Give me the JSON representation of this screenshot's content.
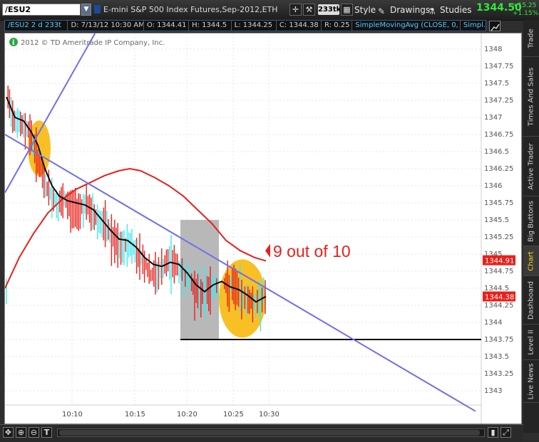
{
  "toolbar": {
    "symbol": "/ESU2",
    "title": "E-mini S&P 500 Index Futures,Sep-2012,ETH",
    "tick_aggregation": "233tk",
    "style_label": "Style",
    "drawings_label": "Drawings",
    "studies_label": "Studies",
    "last_price": "1344.50",
    "net_change": "+15.25",
    "pct_change": "+1.15%"
  },
  "infobar": {
    "symbol": "/ESU2 2 d 233t",
    "datetime": "D: 7/13/12 10:30 AM",
    "open": "O: 1344.41",
    "high": "H: 1344.5",
    "low": "L: 1344.25",
    "close": "C: 1344.38",
    "range": "R: 0.25",
    "study": "SimpleMovingAvg (CLOSE, 0, 0)",
    "study2": "Simpl..."
  },
  "chart": {
    "copyright": "2012 © TD Ameritrade IP Company, Inc.",
    "annotation": "9 out of 10",
    "price_labels": [
      "1348",
      "1347.75",
      "1347.5",
      "1347.25",
      "1347",
      "1346.75",
      "1346.5",
      "1346.25",
      "1346",
      "1345.75",
      "1345.5",
      "1345.25",
      "1345",
      "1344.75",
      "1344.5",
      "1344.25",
      "1344",
      "1343.75",
      "1343.5",
      "1343.25",
      "1343"
    ],
    "time_labels": [
      "10:10",
      "10:15",
      "10:20",
      "10:25",
      "10:30"
    ],
    "ma_marker": "1344.91",
    "last_marker": "1344.38",
    "colors": {
      "red_ma": "#e8201b",
      "black_ma": "#0a0a0a",
      "trendline": "#6e6ef0",
      "up_bar": "#40e8f0",
      "down_bar": "#e8201b",
      "highlight": "#f8b500",
      "box": "#b8b8b8"
    }
  },
  "side_tabs": [
    "Trade",
    "Times And Sales",
    "Active Trader",
    "Big Buttons",
    "Chart",
    "Dashboard",
    "Level II",
    "Live News"
  ],
  "bottom": {
    "buttons": [
      "pan-icon",
      "zoom-in-icon",
      "zoom-out-icon",
      "text-tool-icon"
    ]
  }
}
